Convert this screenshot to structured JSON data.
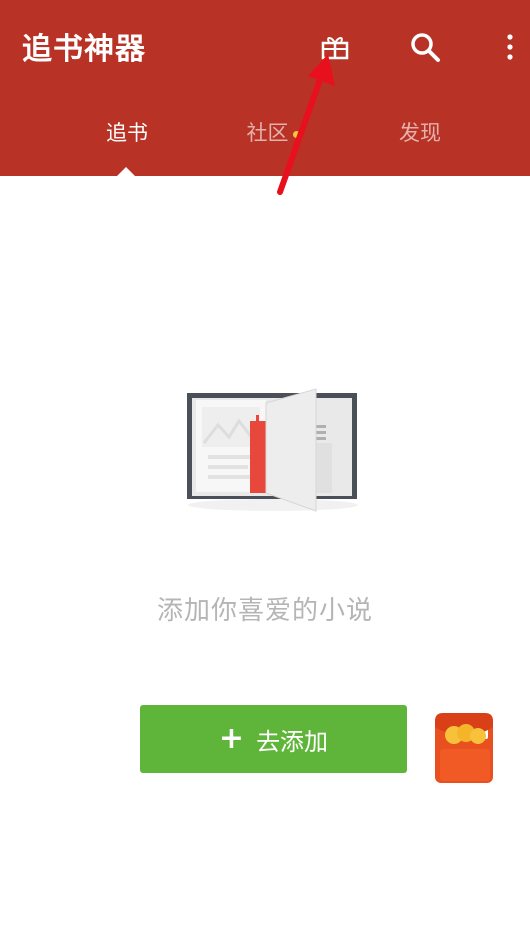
{
  "appbar": {
    "title": "追书神器",
    "actions": {
      "gift": "gift-icon",
      "search": "search-icon",
      "more": "more-vertical-icon"
    }
  },
  "tabs": [
    {
      "label": "追书",
      "active": true
    },
    {
      "label": "社区",
      "active": false,
      "has_badge_dot": true
    },
    {
      "label": "发现",
      "active": false
    }
  ],
  "empty_state": {
    "illustration": "open-book-icon",
    "message": "添加你喜爱的小说"
  },
  "add_button": {
    "label": "去添加",
    "icon": "plus-icon"
  },
  "floating": {
    "icon": "red-packet-icon"
  },
  "colors": {
    "appbar": "#b83226",
    "add_button": "#5fb53a",
    "badge_dot": "#f5c53b",
    "annotation_arrow": "#e8101d"
  }
}
